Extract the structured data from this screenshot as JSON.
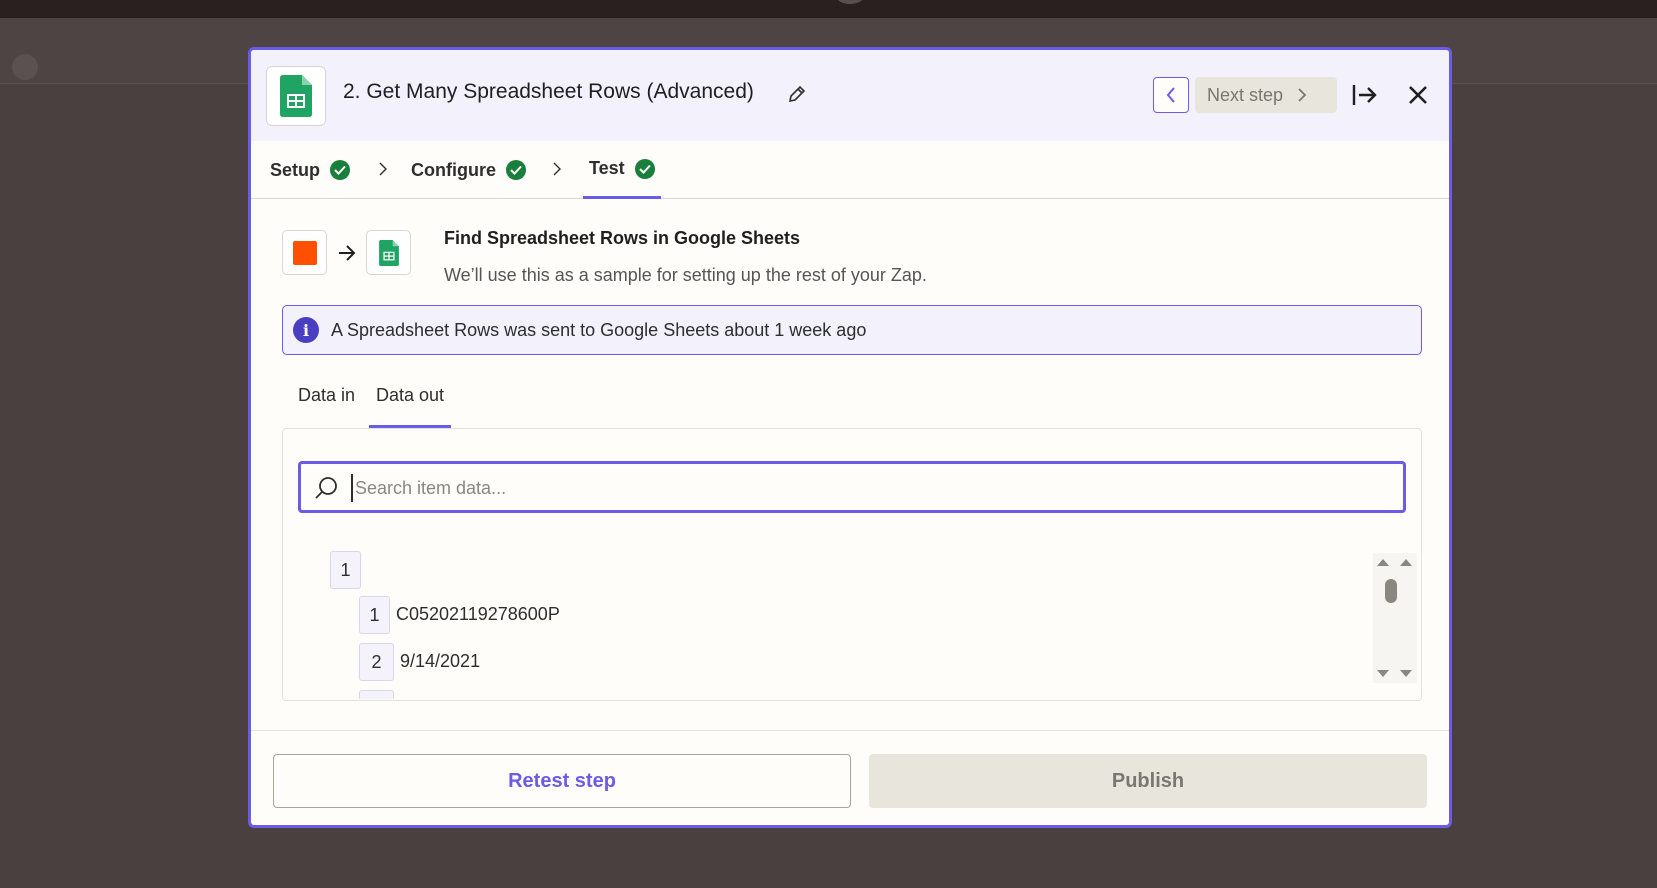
{
  "modal": {
    "title": "2. Get Many Spreadsheet Rows (Advanced)",
    "next_step_label": "Next step"
  },
  "steps": [
    {
      "label": "Setup",
      "status": "complete"
    },
    {
      "label": "Configure",
      "status": "complete"
    },
    {
      "label": "Test",
      "status": "complete",
      "active": true
    }
  ],
  "test": {
    "heading": "Find Spreadsheet Rows in Google Sheets",
    "subheading": "We’ll use this as a sample for setting up the rest of your Zap.",
    "info": "A Spreadsheet Rows was sent to Google Sheets about 1 week ago"
  },
  "data_tabs": [
    {
      "label": "Data in",
      "active": false
    },
    {
      "label": "Data out",
      "active": true
    }
  ],
  "search": {
    "placeholder": "Search item data...",
    "value": ""
  },
  "tree": {
    "root_index": "1",
    "rows": [
      {
        "index": "1",
        "value": "C05202119278600P"
      },
      {
        "index": "2",
        "value": "9/14/2021"
      }
    ]
  },
  "footer": {
    "retest_label": "Retest step",
    "publish_label": "Publish"
  },
  "colors": {
    "accent": "#6b5ce7",
    "success": "#1a7f3c",
    "zapier_orange": "#ff4f00",
    "sheets_green": "#1fa463"
  },
  "icons": [
    "google-sheets-icon",
    "pencil-icon",
    "chevron-left-icon",
    "chevron-right-icon",
    "expand-panel-icon",
    "close-icon",
    "check-circle-icon",
    "arrow-right-icon",
    "info-icon",
    "search-icon",
    "scroll-up-icon",
    "scroll-down-icon"
  ]
}
